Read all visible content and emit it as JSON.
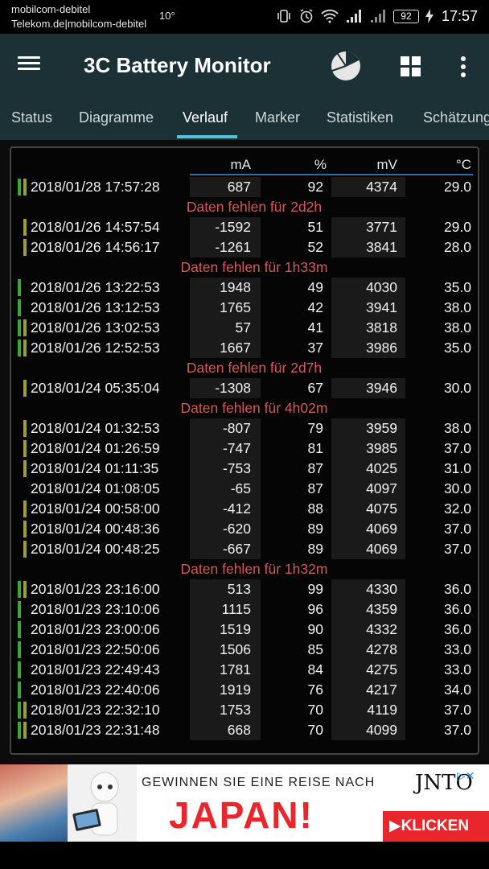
{
  "status_bar": {
    "carrier_line1": "mobilcom-debitel",
    "carrier_line2": "Telekom.de|mobilcom-debitel",
    "temperature": "10°",
    "battery": "92",
    "time": "17:57"
  },
  "app_bar": {
    "title": "3C Battery Monitor"
  },
  "tabs": [
    {
      "label": "Status"
    },
    {
      "label": "Diagramme"
    },
    {
      "label": "Verlauf"
    },
    {
      "label": "Marker"
    },
    {
      "label": "Statistiken"
    },
    {
      "label": "Schätzung"
    }
  ],
  "active_tab": "Verlauf",
  "table": {
    "columns": [
      "mA",
      "%",
      "mV",
      "°C"
    ],
    "colors": {
      "charging": "#3aa63a",
      "discharging": "#9e9e2a",
      "gap_text": "#d45a5a"
    },
    "entries": [
      {
        "kind": "row",
        "bars": [
          "charging",
          "discharging"
        ],
        "datetime": "2018/01/28 17:57:28",
        "ma": "687",
        "pct": "92",
        "mv": "4374",
        "temp": "29.0"
      },
      {
        "kind": "gap",
        "text": "Daten fehlen für 2d2h"
      },
      {
        "kind": "row",
        "bars": [
          "",
          "discharging"
        ],
        "datetime": "2018/01/26 14:57:54",
        "ma": "-1592",
        "pct": "51",
        "mv": "3771",
        "temp": "29.0"
      },
      {
        "kind": "row",
        "bars": [
          "",
          "discharging"
        ],
        "datetime": "2018/01/26 14:56:17",
        "ma": "-1261",
        "pct": "52",
        "mv": "3841",
        "temp": "28.0"
      },
      {
        "kind": "gap",
        "text": "Daten fehlen für 1h33m"
      },
      {
        "kind": "row",
        "bars": [
          "charging",
          ""
        ],
        "datetime": "2018/01/26 13:22:53",
        "ma": "1948",
        "pct": "49",
        "mv": "4030",
        "temp": "35.0"
      },
      {
        "kind": "row",
        "bars": [
          "charging",
          ""
        ],
        "datetime": "2018/01/26 13:12:53",
        "ma": "1765",
        "pct": "42",
        "mv": "3941",
        "temp": "38.0"
      },
      {
        "kind": "row",
        "bars": [
          "charging",
          "discharging"
        ],
        "datetime": "2018/01/26 13:02:53",
        "ma": "57",
        "pct": "41",
        "mv": "3818",
        "temp": "38.0"
      },
      {
        "kind": "row",
        "bars": [
          "charging",
          "discharging"
        ],
        "datetime": "2018/01/26 12:52:53",
        "ma": "1667",
        "pct": "37",
        "mv": "3986",
        "temp": "35.0"
      },
      {
        "kind": "gap",
        "text": "Daten fehlen für 2d7h"
      },
      {
        "kind": "row",
        "bars": [
          "",
          "discharging"
        ],
        "datetime": "2018/01/24 05:35:04",
        "ma": "-1308",
        "pct": "67",
        "mv": "3946",
        "temp": "30.0"
      },
      {
        "kind": "gap",
        "text": "Daten fehlen für 4h02m"
      },
      {
        "kind": "row",
        "bars": [
          "",
          "discharging"
        ],
        "datetime": "2018/01/24 01:32:53",
        "ma": "-807",
        "pct": "79",
        "mv": "3959",
        "temp": "38.0"
      },
      {
        "kind": "row",
        "bars": [
          "",
          "discharging"
        ],
        "datetime": "2018/01/24 01:26:59",
        "ma": "-747",
        "pct": "81",
        "mv": "3985",
        "temp": "37.0"
      },
      {
        "kind": "row",
        "bars": [
          "",
          "discharging"
        ],
        "datetime": "2018/01/24 01:11:35",
        "ma": "-753",
        "pct": "87",
        "mv": "4025",
        "temp": "31.0"
      },
      {
        "kind": "row",
        "bars": [
          "",
          ""
        ],
        "datetime": "2018/01/24 01:08:05",
        "ma": "-65",
        "pct": "87",
        "mv": "4097",
        "temp": "30.0"
      },
      {
        "kind": "row",
        "bars": [
          "",
          "discharging"
        ],
        "datetime": "2018/01/24 00:58:00",
        "ma": "-412",
        "pct": "88",
        "mv": "4075",
        "temp": "32.0"
      },
      {
        "kind": "row",
        "bars": [
          "",
          "discharging"
        ],
        "datetime": "2018/01/24 00:48:36",
        "ma": "-620",
        "pct": "89",
        "mv": "4069",
        "temp": "37.0"
      },
      {
        "kind": "row",
        "bars": [
          "",
          "discharging"
        ],
        "datetime": "2018/01/24 00:48:25",
        "ma": "-667",
        "pct": "89",
        "mv": "4069",
        "temp": "37.0"
      },
      {
        "kind": "gap",
        "text": "Daten fehlen für 1h32m"
      },
      {
        "kind": "row",
        "bars": [
          "charging",
          "discharging"
        ],
        "datetime": "2018/01/23 23:16:00",
        "ma": "513",
        "pct": "99",
        "mv": "4330",
        "temp": "36.0"
      },
      {
        "kind": "row",
        "bars": [
          "charging",
          ""
        ],
        "datetime": "2018/01/23 23:10:06",
        "ma": "1115",
        "pct": "96",
        "mv": "4359",
        "temp": "36.0"
      },
      {
        "kind": "row",
        "bars": [
          "charging",
          ""
        ],
        "datetime": "2018/01/23 23:00:06",
        "ma": "1519",
        "pct": "90",
        "mv": "4332",
        "temp": "36.0"
      },
      {
        "kind": "row",
        "bars": [
          "charging",
          ""
        ],
        "datetime": "2018/01/23 22:50:06",
        "ma": "1506",
        "pct": "85",
        "mv": "4278",
        "temp": "33.0"
      },
      {
        "kind": "row",
        "bars": [
          "charging",
          ""
        ],
        "datetime": "2018/01/23 22:49:43",
        "ma": "1781",
        "pct": "84",
        "mv": "4275",
        "temp": "33.0"
      },
      {
        "kind": "row",
        "bars": [
          "charging",
          ""
        ],
        "datetime": "2018/01/23 22:40:06",
        "ma": "1919",
        "pct": "76",
        "mv": "4217",
        "temp": "34.0"
      },
      {
        "kind": "row",
        "bars": [
          "charging",
          "discharging"
        ],
        "datetime": "2018/01/23 22:32:10",
        "ma": "1753",
        "pct": "70",
        "mv": "4119",
        "temp": "37.0"
      },
      {
        "kind": "row",
        "bars": [
          "charging",
          "discharging"
        ],
        "datetime": "2018/01/23 22:31:48",
        "ma": "668",
        "pct": "70",
        "mv": "4099",
        "temp": "37.0"
      }
    ]
  },
  "ad": {
    "line1": "GEWINNEN SIE EINE REISE NACH",
    "headline": "JAPAN!",
    "brand": "JNTO",
    "cta": "▶KLICKEN"
  },
  "icons": {
    "menu": "hamburger-icon",
    "pie": "pie-chart-icon",
    "grid": "grid-icon",
    "more": "more-vert-icon"
  }
}
